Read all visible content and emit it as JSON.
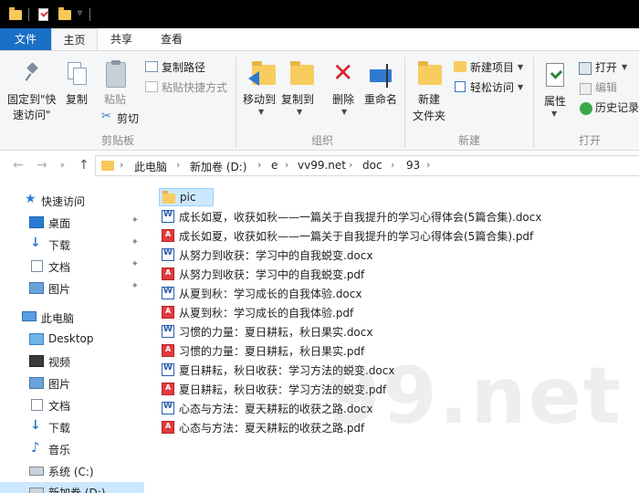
{
  "ribbon_tabs": {
    "file": "文件",
    "home": "主页",
    "share": "共享",
    "view": "查看"
  },
  "clipboard": {
    "pin_line1": "固定到\"快",
    "pin_line2": "速访问\"",
    "copy": "复制",
    "paste": "粘贴",
    "copy_path": "复制路径",
    "paste_shortcut": "粘贴快捷方式",
    "cut": "剪切",
    "group": "剪贴板"
  },
  "organize": {
    "move_to": "移动到",
    "copy_to": "复制到",
    "delete": "删除",
    "rename": "重命名",
    "group": "组织"
  },
  "new": {
    "new_folder_line1": "新建",
    "new_folder_line2": "文件夹",
    "new_item": "新建项目",
    "easy_access": "轻松访问",
    "group": "新建"
  },
  "open": {
    "properties": "属性",
    "open": "打开",
    "edit": "编辑",
    "history": "历史记录",
    "group": "打开"
  },
  "address": {
    "crumbs": [
      "此电脑",
      "新加卷 (D:)",
      "e",
      "vv99.net",
      "doc",
      "93"
    ]
  },
  "nav": {
    "quick_access": "快速访问",
    "desktop": "桌面",
    "downloads": "下载",
    "documents": "文档",
    "pictures": "图片",
    "this_pc": "此电脑",
    "pc_desktop": "Desktop",
    "pc_videos": "视频",
    "pc_pictures": "图片",
    "pc_documents": "文档",
    "pc_downloads": "下载",
    "pc_music": "音乐",
    "drive_c": "系统 (C:)",
    "drive_d": "新加卷 (D:)"
  },
  "files": [
    {
      "name": "pic",
      "type": "folder"
    },
    {
      "name": "成长如夏，收获如秋——一篇关于自我提升的学习心得体会(5篇合集).docx",
      "type": "docx"
    },
    {
      "name": "成长如夏，收获如秋——一篇关于自我提升的学习心得体会(5篇合集).pdf",
      "type": "pdf"
    },
    {
      "name": "从努力到收获：学习中的自我蜕变.docx",
      "type": "docx"
    },
    {
      "name": "从努力到收获：学习中的自我蜕变.pdf",
      "type": "pdf"
    },
    {
      "name": "从夏到秋：学习成长的自我体验.docx",
      "type": "docx"
    },
    {
      "name": "从夏到秋：学习成长的自我体验.pdf",
      "type": "pdf"
    },
    {
      "name": "习惯的力量：夏日耕耘，秋日果实.docx",
      "type": "docx"
    },
    {
      "name": "习惯的力量：夏日耕耘，秋日果实.pdf",
      "type": "pdf"
    },
    {
      "name": "夏日耕耘，秋日收获：学习方法的蜕变.docx",
      "type": "docx"
    },
    {
      "name": "夏日耕耘，秋日收获：学习方法的蜕变.pdf",
      "type": "pdf"
    },
    {
      "name": "心态与方法：夏天耕耘的收获之路.docx",
      "type": "docx"
    },
    {
      "name": "心态与方法：夏天耕耘的收获之路.pdf",
      "type": "pdf"
    }
  ],
  "watermark": "99.net"
}
